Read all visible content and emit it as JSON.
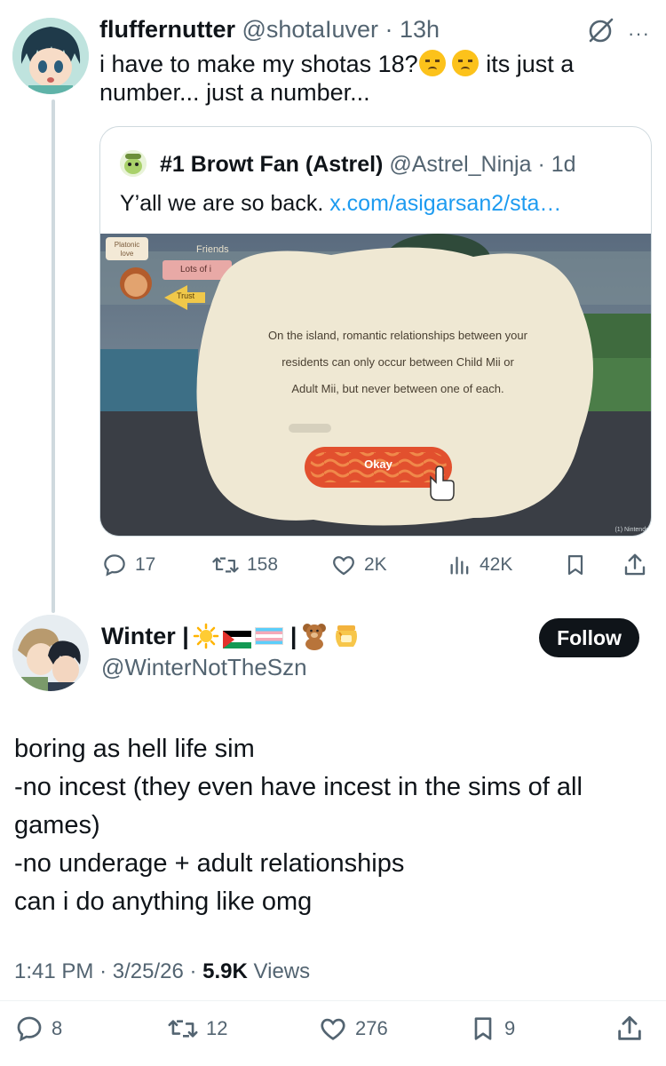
{
  "tweet1": {
    "display_name": "fluffernutter",
    "handle": "@shotaIuver",
    "separator": "·",
    "time": "13h",
    "text_line1": "i have to make my shotas 18?",
    "text_line1_after": " its just a",
    "text_line2": "number... just a number...",
    "emoji": [
      "disappointed-face",
      "disappointed-face"
    ],
    "more_label": "···"
  },
  "quote": {
    "display_name": "#1 Browt Fan (Astrel)",
    "handle": "@Astrel_Ninja",
    "separator": "·",
    "time": "1d",
    "text": "Y’all we are so back. ",
    "link": "x.com/asigarsan2/sta…",
    "media": {
      "dialog_text_line1": "On the island, romantic relationships between your",
      "dialog_text_line2": "residents can only occur between Child Mii or",
      "dialog_text_line3": "Adult Mii, but never between one of each.",
      "button_label": "Okay",
      "tag_platonic": "Platonic love",
      "tag_friends": "Friends",
      "tag_lots": "Lots of i",
      "tag_trust": "Trust",
      "watermark": "(1) Nintendo"
    }
  },
  "tweet1_actions": {
    "replies": "17",
    "reposts": "158",
    "likes": "2K",
    "views": "42K"
  },
  "tweet2": {
    "display_name": "Winter |",
    "name_divider": "|",
    "emoji": [
      "sun",
      "palestine-flag",
      "transgender-flag",
      "teddy-bear",
      "honey-pot"
    ],
    "handle": "@WinterNotTheSzn",
    "follow_label": "Follow",
    "body": [
      "boring as hell life sim",
      "-no incest (they even have incest in the sims of all",
      "games)",
      "-no underage + adult relationships",
      "can i do anything like omg"
    ],
    "time": "1:41 PM",
    "dot": "·",
    "date": "3/25/26",
    "views_count": "5.9K",
    "views_label": "Views"
  },
  "tweet2_actions": {
    "replies": "8",
    "reposts": "12",
    "likes": "276",
    "bookmarks": "9"
  },
  "colors": {
    "text": "#0f1419",
    "muted": "#536471",
    "link": "#1d9bf0",
    "border": "#cfd9de",
    "button": "#0f1419"
  }
}
